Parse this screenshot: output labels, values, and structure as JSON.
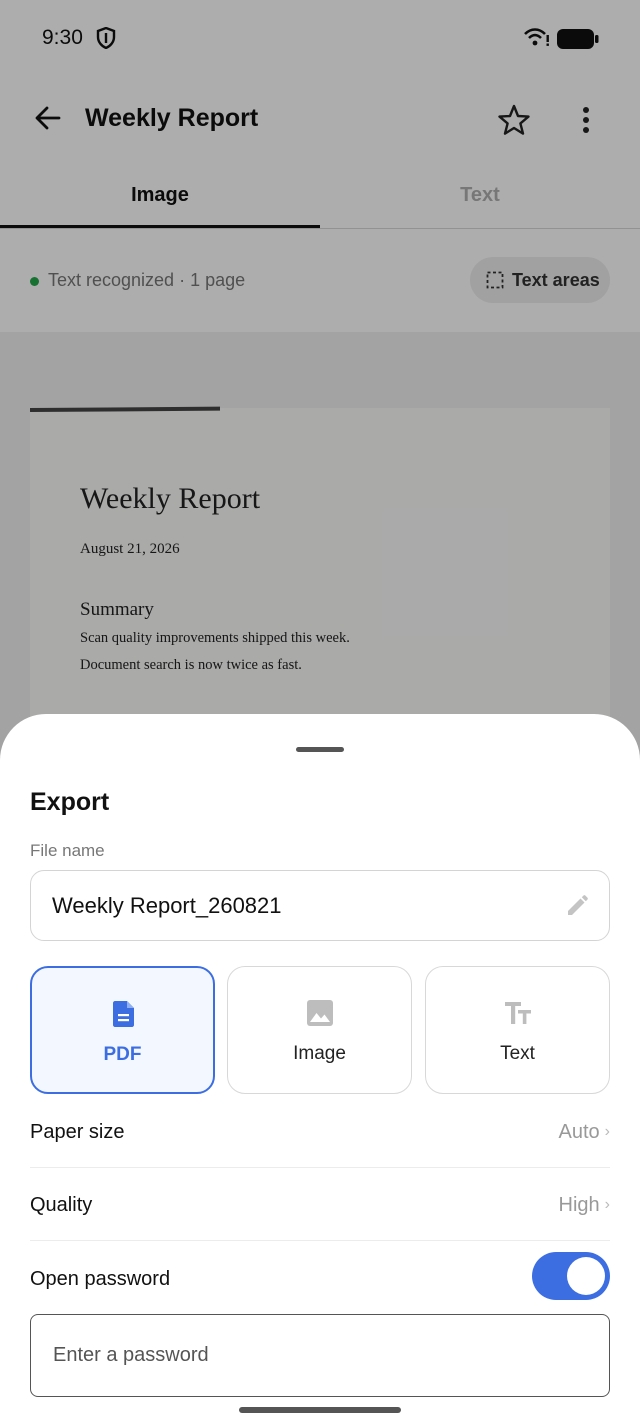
{
  "status_bar": {
    "time": "9:30"
  },
  "app_bar": {
    "title": "Weekly Report"
  },
  "tabs": [
    {
      "label": "Image",
      "selected": true
    },
    {
      "label": "Text",
      "selected": false
    }
  ],
  "info": {
    "status_text": "Text recognized · 1 page",
    "status_color": "#22a84a",
    "text_areas_label": "Text areas"
  },
  "document": {
    "title": "Weekly Report",
    "date": "August 21, 2026",
    "section": "Summary",
    "lines": [
      "Scan quality improvements shipped this week.",
      "Document search is now twice as fast."
    ]
  },
  "export_sheet": {
    "title": "Export",
    "file_name_label": "File name",
    "file_name_value": "Weekly Report_260821",
    "formats": [
      {
        "label": "PDF",
        "icon": "pdf-file-icon",
        "selected": true
      },
      {
        "label": "Image",
        "icon": "image-icon",
        "selected": false
      },
      {
        "label": "Text",
        "icon": "text-format-icon",
        "selected": false
      }
    ],
    "settings": {
      "paper_size": {
        "label": "Paper size",
        "value": "Auto"
      },
      "quality": {
        "label": "Quality",
        "value": "High"
      },
      "open_password": {
        "label": "Open password",
        "enabled": true
      }
    },
    "password_placeholder": "Enter a password",
    "accent_color": "#3c6ee2"
  }
}
